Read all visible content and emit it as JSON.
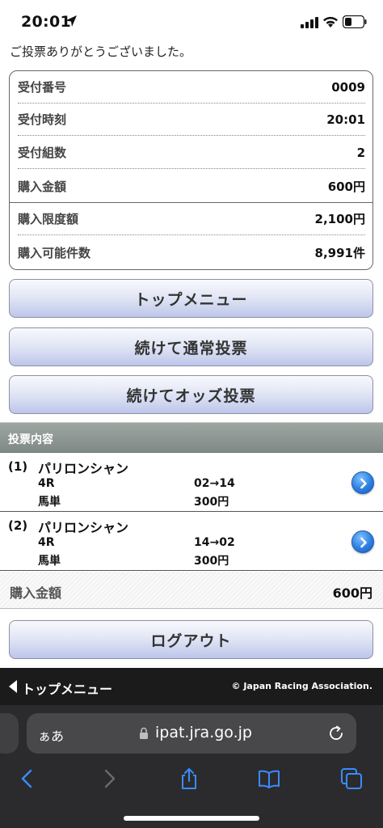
{
  "status_bar": {
    "time": "20:01"
  },
  "thanks_message": "ご投票ありがとうございました。",
  "summary": {
    "rows": [
      {
        "label": "受付番号",
        "value": "0009"
      },
      {
        "label": "受付時刻",
        "value": "20:01"
      },
      {
        "label": "受付組数",
        "value": "2"
      },
      {
        "label": "購入金額",
        "value": "600円"
      },
      {
        "label": "購入限度額",
        "value": "2,100円"
      },
      {
        "label": "購入可能件数",
        "value": "8,991件"
      }
    ]
  },
  "buttons": {
    "top_menu": "トップメニュー",
    "continue_normal": "続けて通常投票",
    "continue_odds": "続けてオッズ投票",
    "logout": "ログアウト"
  },
  "vote_section": {
    "title": "投票内容",
    "entries": [
      {
        "num": "(1)",
        "name": "パリロンシャン",
        "race": "4R",
        "bet_type": "馬単",
        "combo": "02→14",
        "amount": "300円"
      },
      {
        "num": "(2)",
        "name": "パリロンシャン",
        "race": "4R",
        "bet_type": "馬単",
        "combo": "14→02",
        "amount": "300円"
      }
    ],
    "total_label": "購入金額",
    "total_value": "600円"
  },
  "footer": {
    "top_menu_link": "トップメニュー",
    "copyright": "© Japan Racing Association."
  },
  "browser": {
    "aa_label": "ぁあ",
    "url": "ipat.jra.go.jp"
  },
  "icons": {
    "location": "location-arrow-icon",
    "signal": "cellular-signal-icon",
    "wifi": "wifi-icon",
    "battery": "battery-icon",
    "chevron": "chevron-right-circle-icon",
    "lock": "lock-icon",
    "reload": "reload-icon",
    "back": "back-icon",
    "forward": "forward-icon",
    "share": "share-icon",
    "bookmarks": "bookmarks-icon",
    "tabs": "tabs-icon"
  },
  "colors": {
    "button_gradient_bottom": "#bcc6ea",
    "section_header": "#8d9692",
    "accent_blue": "#2c7fe0",
    "footer_bg": "#1b1b1b",
    "safari_bg": "#2b2b2d",
    "safari_icon": "#3a8bff"
  }
}
